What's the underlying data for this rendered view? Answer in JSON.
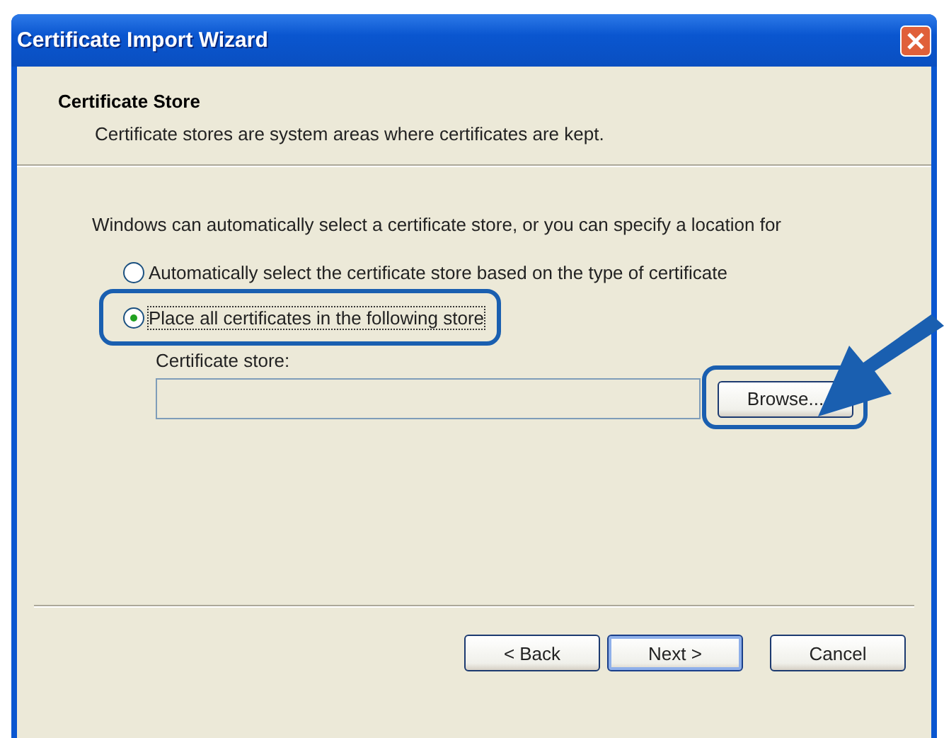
{
  "window": {
    "title": "Certificate Import Wizard"
  },
  "header": {
    "title": "Certificate Store",
    "subtitle": "Certificate stores are system areas where certificates are kept."
  },
  "intro": "Windows can automatically select a certificate store, or you can specify a location for",
  "options": [
    {
      "label": "Automatically select the certificate store based on the type of certificate",
      "selected": false,
      "highlighted": false
    },
    {
      "label": "Place all certificates in the following store",
      "selected": true,
      "highlighted": true
    }
  ],
  "store": {
    "label": "Certificate store:",
    "browse": {
      "label": "Browse...",
      "highlighted": true
    }
  },
  "buttons": [
    {
      "label": "< Back",
      "default": false
    },
    {
      "label": "Next >",
      "default": true
    },
    {
      "label": "Cancel",
      "default": false
    }
  ]
}
